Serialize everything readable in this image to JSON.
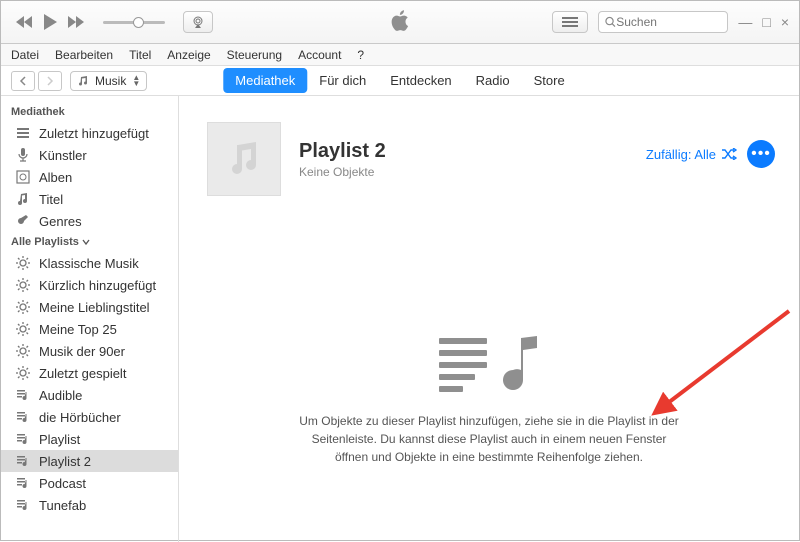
{
  "search": {
    "placeholder": "Suchen"
  },
  "menubar": [
    "Datei",
    "Bearbeiten",
    "Titel",
    "Anzeige",
    "Steuerung",
    "Account",
    "?"
  ],
  "mediaSelector": {
    "label": "Musik"
  },
  "tabs": [
    {
      "label": "Mediathek",
      "active": true
    },
    {
      "label": "Für dich",
      "active": false
    },
    {
      "label": "Entdecken",
      "active": false
    },
    {
      "label": "Radio",
      "active": false
    },
    {
      "label": "Store",
      "active": false
    }
  ],
  "sidebar": {
    "sections": [
      {
        "title": "Mediathek",
        "chevron": false,
        "items": [
          {
            "icon": "list",
            "label": "Zuletzt hinzugefügt",
            "sel": false
          },
          {
            "icon": "mic",
            "label": "Künstler",
            "sel": false
          },
          {
            "icon": "album",
            "label": "Alben",
            "sel": false
          },
          {
            "icon": "note",
            "label": "Titel",
            "sel": false
          },
          {
            "icon": "guitar",
            "label": "Genres",
            "sel": false
          }
        ]
      },
      {
        "title": "Alle Playlists",
        "chevron": true,
        "items": [
          {
            "icon": "gear",
            "label": "Klassische Musik",
            "sel": false
          },
          {
            "icon": "gear",
            "label": "Kürzlich hinzugefügt",
            "sel": false
          },
          {
            "icon": "gear",
            "label": "Meine Lieblingstitel",
            "sel": false
          },
          {
            "icon": "gear",
            "label": "Meine Top 25",
            "sel": false
          },
          {
            "icon": "gear",
            "label": "Musik der 90er",
            "sel": false
          },
          {
            "icon": "gear",
            "label": "Zuletzt gespielt",
            "sel": false
          },
          {
            "icon": "playlist",
            "label": "Audible",
            "sel": false
          },
          {
            "icon": "playlist",
            "label": "die Hörbücher",
            "sel": false
          },
          {
            "icon": "playlist",
            "label": "Playlist",
            "sel": false
          },
          {
            "icon": "playlist",
            "label": "Playlist 2",
            "sel": true
          },
          {
            "icon": "playlist",
            "label": "Podcast",
            "sel": false
          },
          {
            "icon": "playlist",
            "label": "Tunefab",
            "sel": false
          }
        ]
      }
    ]
  },
  "playlist": {
    "title": "Playlist 2",
    "subtitle": "Keine Objekte",
    "shuffle": "Zufällig: Alle"
  },
  "empty": {
    "text": "Um Objekte zu dieser Playlist hinzufügen, ziehe sie in die Playlist in der Seitenleiste. Du kannst diese Playlist auch in einem neuen Fenster öffnen und Objekte in eine bestimmte Reihenfolge ziehen."
  }
}
